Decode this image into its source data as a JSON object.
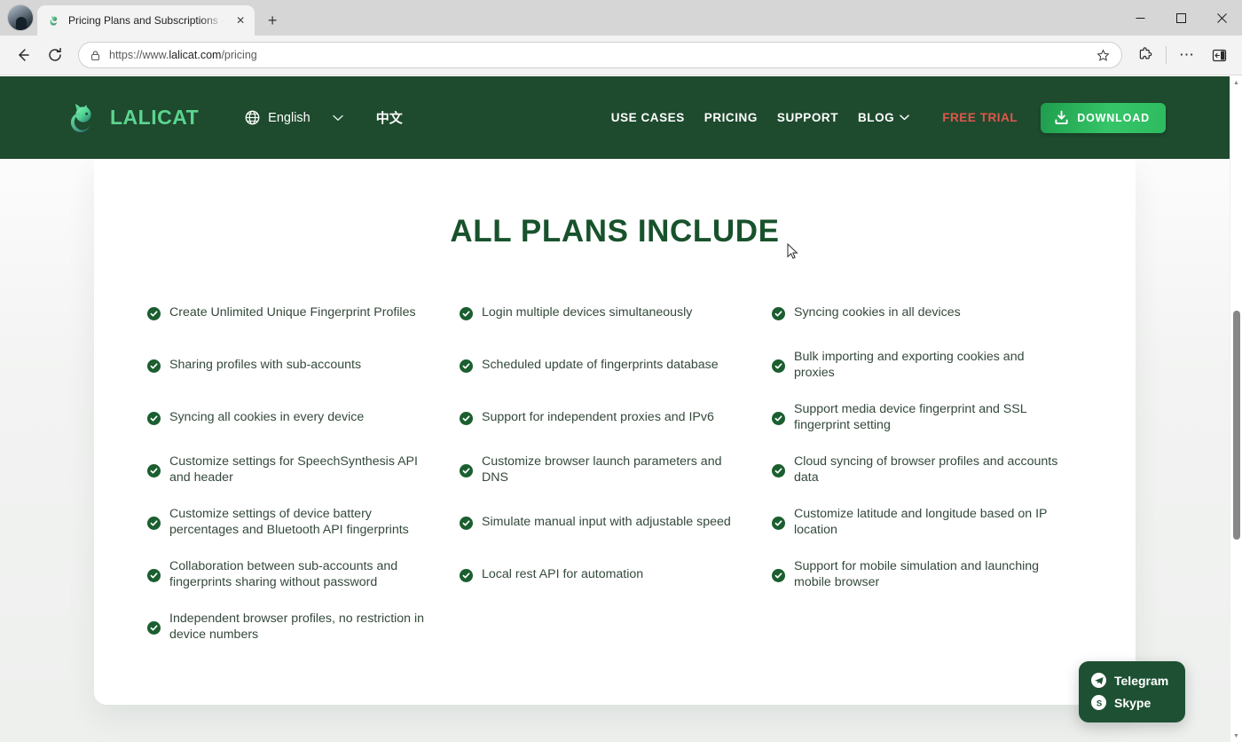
{
  "browser": {
    "tab": {
      "title": "Pricing Plans and Subscriptions -",
      "favicon_name": "lalicat-favicon",
      "close_label": "✕"
    },
    "new_tab_label": "+",
    "window_controls": {
      "minimize": "─",
      "maximize": "□",
      "close": "✕"
    },
    "toolbar": {
      "back_label": "←",
      "reload_label": "⟳",
      "lock_icon": "lock-icon",
      "url_scheme": "https://www.",
      "url_host": "lalicat.com",
      "url_path": "/pricing",
      "url_full": "https://www.lalicat.com/pricing",
      "star_label": "☆",
      "extensions_label": "extensions-icon",
      "more_label": "⋯",
      "sidebar_label": "sidebar-icon"
    }
  },
  "site": {
    "brand": {
      "name": "LALICAT",
      "logo_name": "lalicat-cat-logo"
    },
    "language": {
      "globe_icon": "globe-icon",
      "current": "English",
      "caret": "∨",
      "alt": "中文"
    },
    "nav": [
      {
        "label": "USE CASES",
        "type": "link"
      },
      {
        "label": "PRICING",
        "type": "link"
      },
      {
        "label": "SUPPORT",
        "type": "link"
      },
      {
        "label": "BLOG",
        "type": "dropdown",
        "caret": "∨"
      },
      {
        "label": "FREE TRIAL",
        "type": "accent",
        "color": "#e2574c"
      }
    ],
    "download_button": {
      "label": "DOWNLOAD",
      "icon": "download-icon",
      "color": "#2ebb5f"
    }
  },
  "main": {
    "title": "ALL PLANS INCLUDE",
    "accent_color": "#18522c",
    "check_icon": "check-circle-icon",
    "columns": [
      [
        "Create Unlimited Unique Fingerprint Profiles",
        "Sharing profiles with sub-accounts",
        "Syncing all cookies in every device",
        "Customize settings for SpeechSynthesis API and header",
        "Customize settings of device battery percentages and Bluetooth API fingerprints",
        "Collaboration between sub-accounts and fingerprints sharing without password",
        "Independent browser profiles, no restriction in device numbers"
      ],
      [
        "Login multiple devices simultaneously",
        "Scheduled update of fingerprints database",
        "Support for independent proxies and IPv6",
        "Customize browser launch parameters and DNS",
        "Simulate manual input with adjustable speed",
        "Local rest API for automation"
      ],
      [
        "Syncing cookies in all devices",
        "Bulk importing and exporting cookies and proxies",
        "Support media device fingerprint and SSL fingerprint setting",
        "Cloud syncing of browser profiles and accounts data",
        "Customize latitude and longitude based on IP location",
        "Support for mobile simulation and launching mobile browser"
      ]
    ]
  },
  "chat_widget": {
    "items": [
      {
        "label": "Telegram",
        "icon": "telegram-icon"
      },
      {
        "label": "Skype",
        "icon": "skype-icon"
      }
    ],
    "background": "#1e5133"
  }
}
